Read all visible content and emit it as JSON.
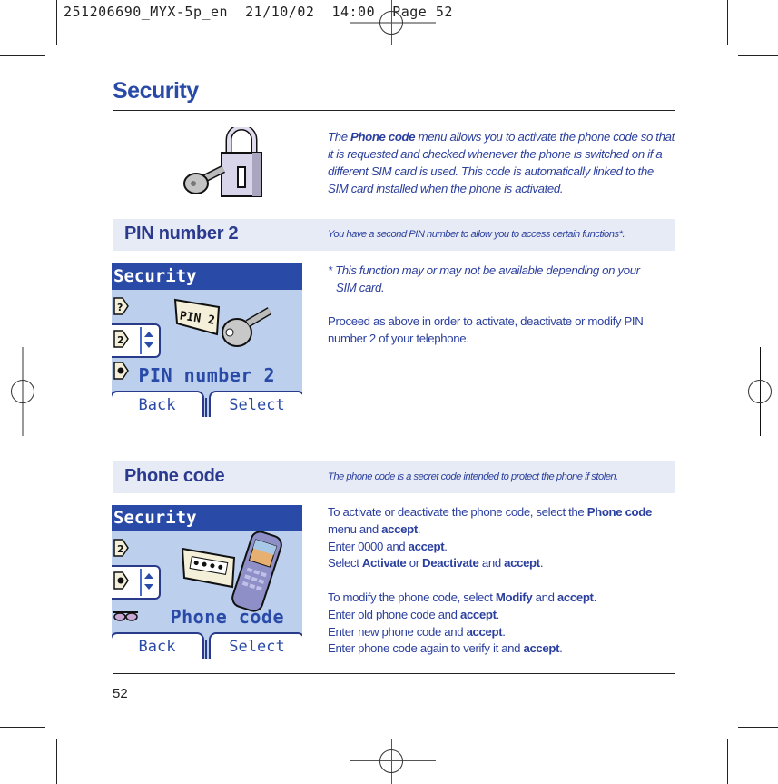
{
  "print_slug": "251206690_MYX-5p_en  21/10/02  14:00  Page 52",
  "page": {
    "title": "Security",
    "page_number": "52",
    "accent_color": "#2a4aa8",
    "band_color": "#e6ebf6"
  },
  "intro": {
    "prefix": "The ",
    "bold": "Phone code",
    "suffix": " menu allows you to activate the phone code so that it is requested and checked whenever the phone is switched on if a different SIM card is used. This code is automatically linked to the SIM card installed when the phone is activated."
  },
  "sections": [
    {
      "heading": "PIN number 2",
      "subtitle": "You have a second PIN number to allow you to access certain functions*.",
      "screen": {
        "title": "Security",
        "label": "PIN number 2",
        "soft_left": "Back",
        "soft_right": "Select",
        "icons": [
          "menu-icon-question",
          "menu-icon-2",
          "menu-icon-3"
        ],
        "illustration": "pin2-key-icon"
      },
      "footnote_line1": "* This function may or may not be available depending on your",
      "footnote_line2": "SIM card.",
      "paragraph": "Proceed as above in order to activate, deactivate or modify PIN number 2 of your telephone."
    },
    {
      "heading": "Phone code",
      "subtitle": "The phone code is a secret code intended to protect the phone if stolen.",
      "screen": {
        "title": "Security",
        "label": "Phone code",
        "soft_left": "Back",
        "soft_right": "Select",
        "icons": [
          "menu-icon-2",
          "menu-icon-3",
          "glasses-icon"
        ],
        "illustration": "phone-code-icon"
      },
      "steps_a": [
        {
          "t": "To activate or deactivate the phone code, select the ",
          "b": "Phone code",
          "t2": " menu and ",
          "b2": "accept",
          "t3": "."
        },
        {
          "t": "Enter 0000 and ",
          "b": "accept",
          "t2": "."
        },
        {
          "t": "Select ",
          "b": "Activate",
          "t2": " or ",
          "b2": "Deactivate",
          "t3": " and ",
          "b3": "accept",
          "t4": "."
        }
      ],
      "steps_b": [
        {
          "t": "To modify the phone code, select ",
          "b": "Modify",
          "t2": " and ",
          "b2": "accept",
          "t3": "."
        },
        {
          "t": "Enter old phone code and ",
          "b": "accept",
          "t2": "."
        },
        {
          "t": "Enter new phone code and ",
          "b": "accept",
          "t2": "."
        },
        {
          "t": "Enter phone code again to verify it and ",
          "b": "accept",
          "t2": "."
        }
      ]
    }
  ]
}
